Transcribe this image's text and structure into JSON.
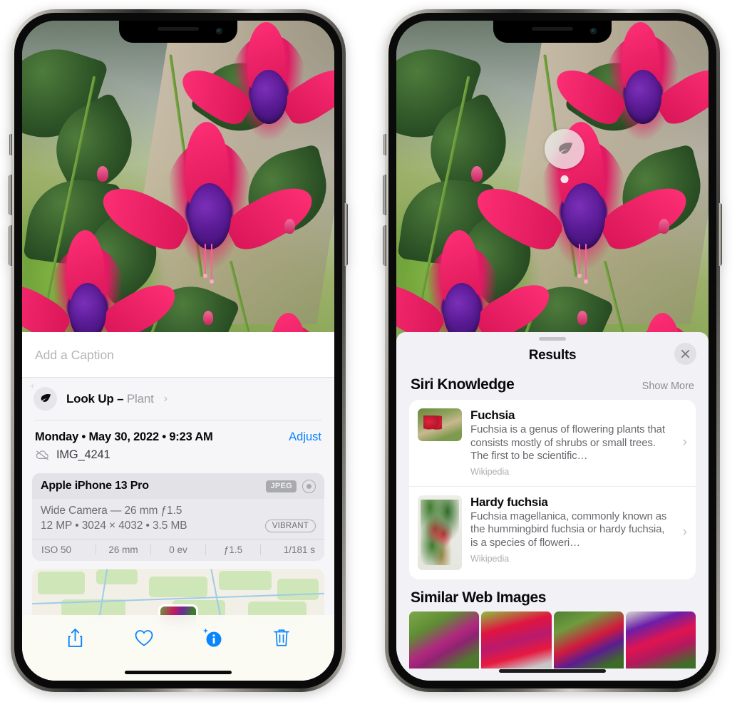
{
  "left_phone": {
    "caption_field": {
      "placeholder": "Add a Caption",
      "value": ""
    },
    "lookup_row": {
      "label": "Look Up –",
      "subject": "Plant",
      "chevron": "chevron-right",
      "icon": "leaf-icon",
      "sparkle_icon": "sparkle-icon"
    },
    "date_row": {
      "date": "Monday • May 30, 2022 • 9:23 AM",
      "adjust_label": "Adjust"
    },
    "file_row": {
      "cloud_icon": "cloud-slash-icon",
      "filename": "IMG_4241"
    },
    "camera_card": {
      "model": "Apple iPhone 13 Pro",
      "format_badge": "JPEG",
      "hdr_icon": "hdr-circle-icon",
      "lens_line": "Wide Camera — 26 mm ƒ1.5",
      "specs_line": "12 MP • 3024 × 4032 • 3.5 MB",
      "style_badge": "VIBRANT",
      "exif": [
        "ISO 50",
        "26 mm",
        "0 ev",
        "ƒ1.5",
        "1/181 s"
      ]
    },
    "toolbar": {
      "share_label": "share-icon",
      "favorite_label": "heart-icon",
      "info_label": "info-sparkle-icon",
      "delete_label": "trash-icon",
      "accent": "#0a84ff"
    }
  },
  "right_phone": {
    "visual_lookup_badge": {
      "icon": "leaf-icon"
    },
    "sheet": {
      "grabber": "drag-handle",
      "title": "Results",
      "close_icon": "close-icon"
    },
    "siri_knowledge": {
      "title": "Siri Knowledge",
      "show_more": "Show More",
      "items": [
        {
          "title": "Fuchsia",
          "description": "Fuchsia is a genus of flowering plants that consists mostly of shrubs or small trees. The first to be scientific…",
          "source": "Wikipedia",
          "chevron": "chevron-right"
        },
        {
          "title": "Hardy fuchsia",
          "description": "Fuchsia magellanica, commonly known as the hummingbird fuchsia or hardy fuchsia, is a species of floweri…",
          "source": "Wikipedia",
          "chevron": "chevron-right"
        }
      ]
    },
    "similar_web_images": {
      "title": "Similar Web Images",
      "thumbnails": [
        "fuchsia-web-1",
        "fuchsia-web-2",
        "fuchsia-web-3",
        "fuchsia-web-4"
      ]
    }
  }
}
